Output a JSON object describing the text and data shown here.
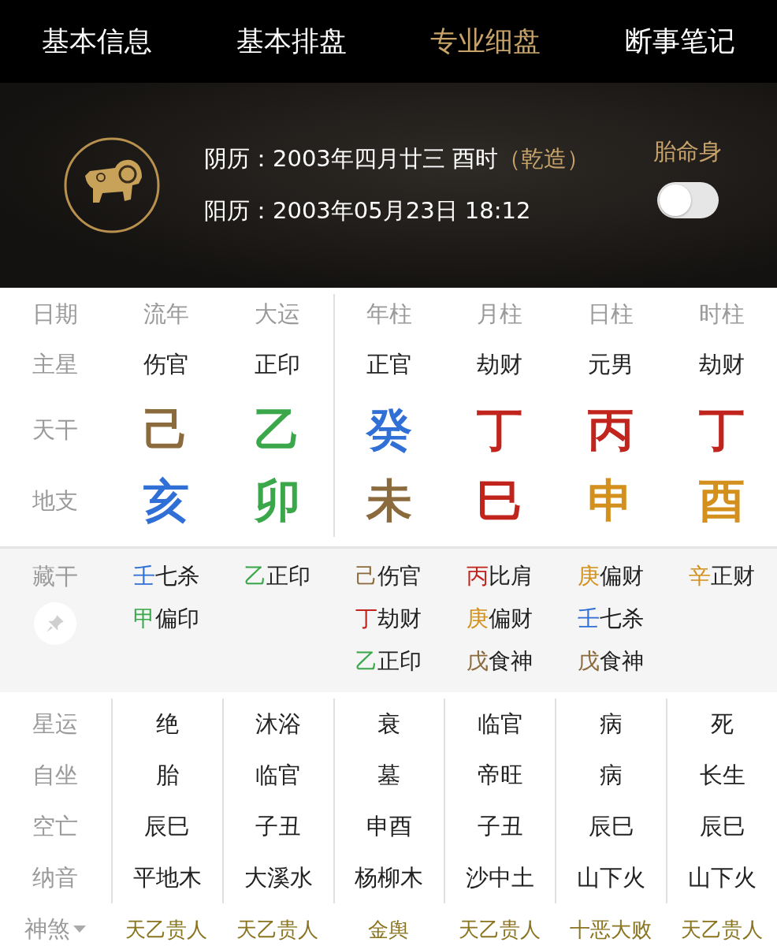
{
  "tabs": [
    {
      "label": "基本信息",
      "selected": false
    },
    {
      "label": "基本排盘",
      "selected": false
    },
    {
      "label": "专业细盘",
      "selected": true
    },
    {
      "label": "断事笔记",
      "selected": false
    }
  ],
  "header": {
    "lunar": {
      "label": "阴历：",
      "value": "2003年四月廿三 酉时",
      "gender": "（乾造）"
    },
    "solar": {
      "label": "阳历：",
      "value": "2003年05月23日 18:12"
    },
    "toggle": {
      "label": "胎命身",
      "on": false
    }
  },
  "pillars": {
    "columns": [
      "日期",
      "流年",
      "大运",
      "年柱",
      "月柱",
      "日柱",
      "时柱"
    ],
    "main_star": {
      "label": "主星",
      "values": [
        "伤官",
        "正印",
        "正官",
        "劫财",
        "元男",
        "劫财"
      ]
    },
    "stems": {
      "label": "天干",
      "items": [
        {
          "char": "己",
          "color": "#8b6b3d"
        },
        {
          "char": "乙",
          "color": "#3aa84a"
        },
        {
          "char": "癸",
          "color": "#2f6fd6"
        },
        {
          "char": "丁",
          "color": "#c0241d"
        },
        {
          "char": "丙",
          "color": "#c0241d"
        },
        {
          "char": "丁",
          "color": "#c0241d"
        }
      ]
    },
    "branches": {
      "label": "地支",
      "items": [
        {
          "char": "亥",
          "color": "#2f6fd6"
        },
        {
          "char": "卯",
          "color": "#3aa84a"
        },
        {
          "char": "未",
          "color": "#8b6b3d"
        },
        {
          "char": "巳",
          "color": "#c0241d"
        },
        {
          "char": "申",
          "color": "#d4901c"
        },
        {
          "char": "酉",
          "color": "#d4901c"
        }
      ]
    }
  },
  "hidden_stems": {
    "label": "藏干",
    "columns": [
      [
        {
          "char": "壬",
          "color": "#2f6fd6",
          "god": "七杀"
        },
        {
          "char": "甲",
          "color": "#3aa84a",
          "god": "偏印"
        }
      ],
      [
        {
          "char": "乙",
          "color": "#3aa84a",
          "god": "正印"
        }
      ],
      [
        {
          "char": "己",
          "color": "#8b6b3d",
          "god": "伤官"
        },
        {
          "char": "丁",
          "color": "#c0241d",
          "god": "劫财"
        },
        {
          "char": "乙",
          "color": "#3aa84a",
          "god": "正印"
        }
      ],
      [
        {
          "char": "丙",
          "color": "#c0241d",
          "god": "比肩"
        },
        {
          "char": "庚",
          "color": "#d4901c",
          "god": "偏财"
        },
        {
          "char": "戊",
          "color": "#8b6b3d",
          "god": "食神"
        }
      ],
      [
        {
          "char": "庚",
          "color": "#d4901c",
          "god": "偏财"
        },
        {
          "char": "壬",
          "color": "#2f6fd6",
          "god": "七杀"
        },
        {
          "char": "戊",
          "color": "#8b6b3d",
          "god": "食神"
        }
      ],
      [
        {
          "char": "辛",
          "color": "#d4901c",
          "god": "正财"
        }
      ]
    ]
  },
  "rows": [
    {
      "label": "星运",
      "values": [
        "绝",
        "沐浴",
        "衰",
        "临官",
        "病",
        "死"
      ]
    },
    {
      "label": "自坐",
      "values": [
        "胎",
        "临官",
        "墓",
        "帝旺",
        "病",
        "长生"
      ]
    },
    {
      "label": "空亡",
      "values": [
        "辰巳",
        "子丑",
        "申酉",
        "子丑",
        "辰巳",
        "辰巳"
      ]
    },
    {
      "label": "纳音",
      "values": [
        "平地木",
        "大溪水",
        "杨柳木",
        "沙中土",
        "山下火",
        "山下火"
      ]
    }
  ],
  "shensha": {
    "label": "神煞",
    "values": [
      "天乙贵人",
      "天乙贵人",
      "金舆",
      "天乙贵人",
      "十恶大败",
      "天乙贵人"
    ]
  }
}
